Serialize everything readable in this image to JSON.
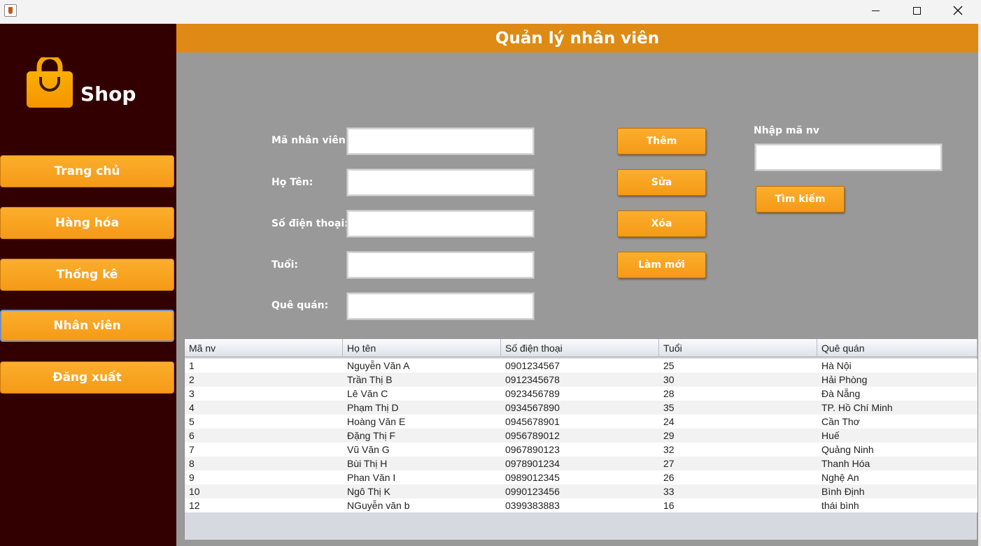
{
  "window": {
    "icon": "java-cup-icon"
  },
  "sidebar": {
    "logo_text": "Shop",
    "logo_icon": "shopping-bag-icon",
    "items": [
      {
        "label": "Trang chủ"
      },
      {
        "label": "Hàng hóa"
      },
      {
        "label": "Thống kê"
      },
      {
        "label": "Nhân viên"
      },
      {
        "label": "Đăng xuất"
      }
    ]
  },
  "header": {
    "title": "Quản lý nhân viên"
  },
  "form": {
    "ma_label": "Mã nhân viên:",
    "ma_value": "",
    "ten_label": "Họ Tên:",
    "ten_value": "",
    "sdt_label": "Số điện thoại:",
    "sdt_value": "",
    "tuoi_label": "Tuổi:",
    "tuoi_value": "",
    "que_label": "Quê quán:",
    "que_value": ""
  },
  "actions": {
    "add": "Thêm",
    "edit": "Sửa",
    "delete": "Xóa",
    "refresh": "Làm mới"
  },
  "search": {
    "label": "Nhập mã nv",
    "value": "",
    "button": "Tìm kiếm"
  },
  "table": {
    "columns": [
      "Mã nv",
      "Họ tên",
      "Số điện thoại",
      "Tuổi",
      "Quê quán"
    ],
    "rows": [
      [
        "1",
        "Nguyễn Văn A",
        "0901234567",
        "25",
        "Hà Nội"
      ],
      [
        "2",
        "Trần Thị B",
        "0912345678",
        "30",
        "Hải Phòng"
      ],
      [
        "3",
        "Lê Văn C",
        "0923456789",
        "28",
        "Đà Nẵng"
      ],
      [
        "4",
        "Phạm Thị D",
        "0934567890",
        "35",
        "TP. Hồ Chí Minh"
      ],
      [
        "5",
        "Hoàng Văn E",
        "0945678901",
        "24",
        "Cần Thơ"
      ],
      [
        "6",
        "Đặng Thị F",
        "0956789012",
        "29",
        "Huế"
      ],
      [
        "7",
        "Vũ Văn G",
        "0967890123",
        "32",
        "Quảng Ninh"
      ],
      [
        "8",
        "Bùi Thị H",
        "0978901234",
        "27",
        "Thanh Hóa"
      ],
      [
        "9",
        "Phan Văn I",
        "0989012345",
        "26",
        "Nghệ An"
      ],
      [
        "10",
        "Ngô Thị K",
        "0990123456",
        "33",
        "Bình Định"
      ],
      [
        "12",
        "NGuyễn văn b",
        "0399383883",
        "16",
        "thái bình"
      ]
    ]
  }
}
